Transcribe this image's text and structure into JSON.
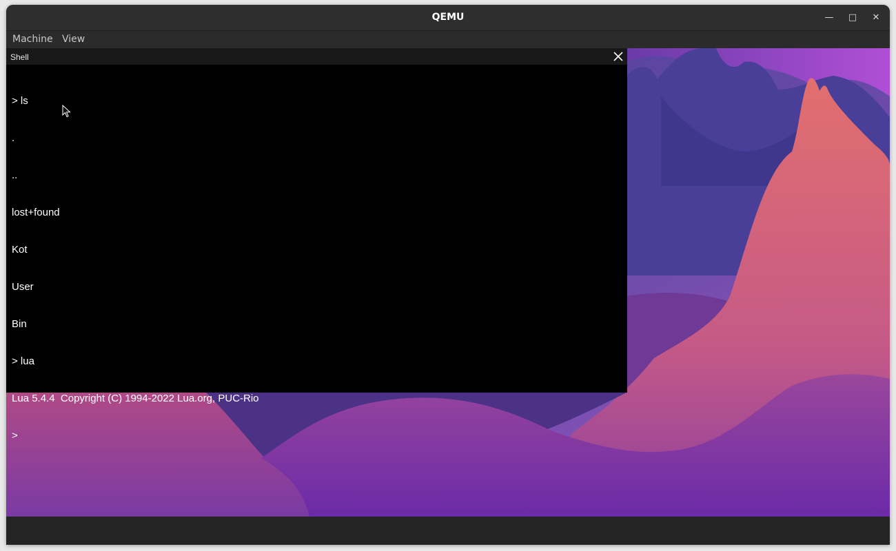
{
  "window": {
    "title": "QEMU",
    "controls": {
      "minimize": "—",
      "maximize": "□",
      "close": "✕"
    }
  },
  "menubar": {
    "items": [
      {
        "label": "Machine"
      },
      {
        "label": "View"
      }
    ]
  },
  "shell": {
    "title": "Shell",
    "lines": [
      "> ls",
      ".",
      "..",
      "lost+found",
      "Kot",
      "User",
      "Bin",
      "> lua",
      "Lua 5.4.4  Copyright (C) 1994-2022 Lua.org, PUC-Rio",
      ">"
    ]
  },
  "colors": {
    "wallpaper_top": "#3f3c9a",
    "wallpaper_mid": "#8a4fb0",
    "peak": "#d9667c",
    "terminal_bg": "#000000",
    "terminal_fg": "#ffffff"
  },
  "icons": {
    "shell_close": "close-icon",
    "pointer": "mouse-pointer-icon"
  }
}
